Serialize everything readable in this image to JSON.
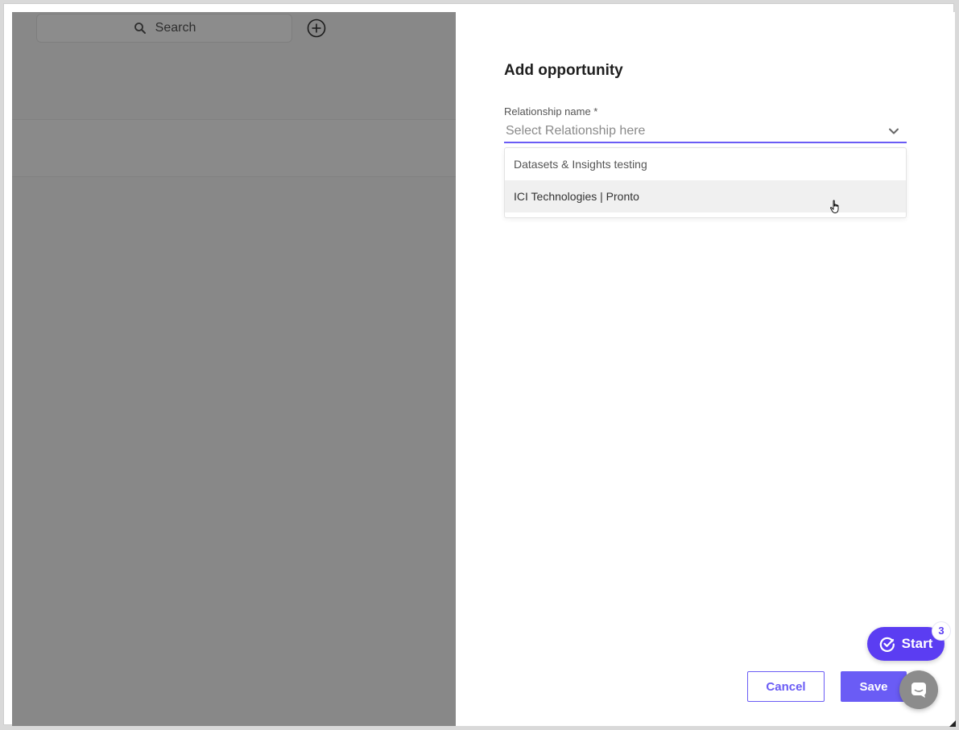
{
  "background": {
    "search_label": "Search"
  },
  "panel": {
    "title": "Add opportunity",
    "relationship_label": "Relationship name *",
    "relationship_placeholder": "Select Relationship here",
    "options": [
      {
        "label": "Datasets & Insights testing"
      },
      {
        "label": "ICI Technologies | Pronto"
      }
    ],
    "hovered_option_index": 1
  },
  "footer": {
    "cancel_label": "Cancel",
    "save_label": "Save"
  },
  "widgets": {
    "start_label": "Start",
    "start_badge": "3"
  },
  "colors": {
    "accent": "#6a5cf5",
    "start_button": "#5b3df2",
    "overlay": "rgba(0,0,0,0.45)"
  },
  "icons": [
    "search-icon",
    "plus-circle-icon",
    "chevron-down-icon",
    "hand-cursor-icon",
    "check-circle-icon",
    "chat-icon"
  ]
}
